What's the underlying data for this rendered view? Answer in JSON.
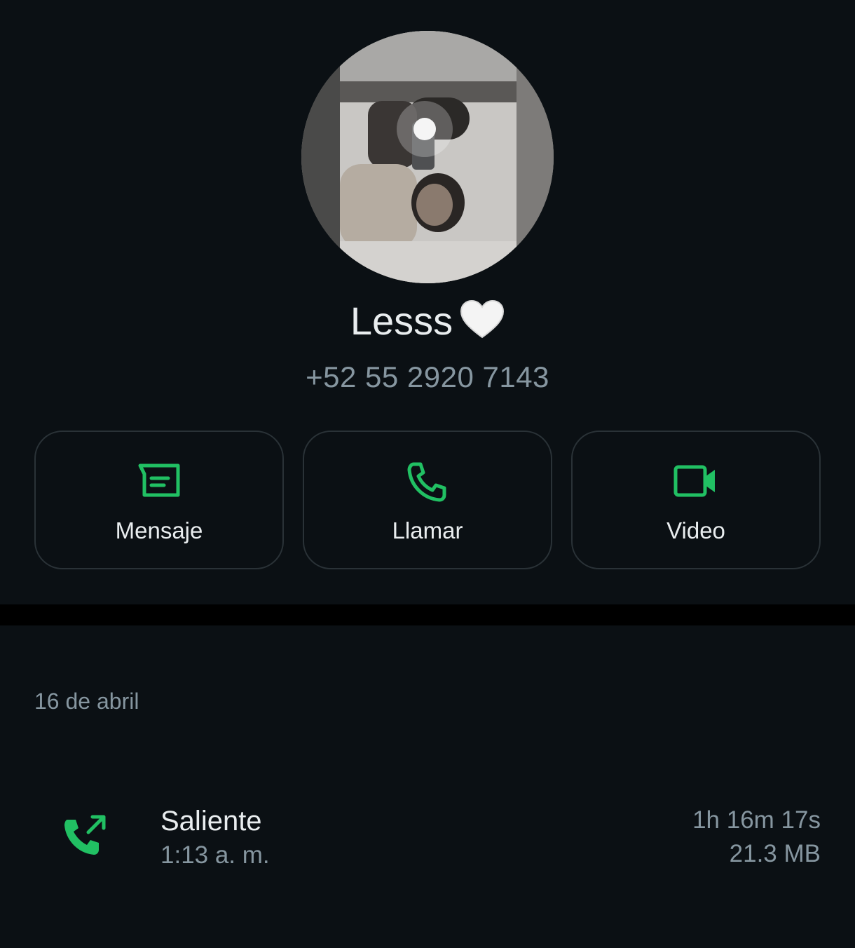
{
  "contact": {
    "name": "Lesss",
    "emoji_icon": "white-heart-icon",
    "phone": "+52 55 2920 7143"
  },
  "actions": [
    {
      "label": "Mensaje",
      "icon": "message-icon"
    },
    {
      "label": "Llamar",
      "icon": "phone-icon"
    },
    {
      "label": "Video",
      "icon": "video-icon"
    }
  ],
  "calls": {
    "date": "16 de abril",
    "entries": [
      {
        "type": "Saliente",
        "time": "1:13 a. m.",
        "duration": "1h 16m 17s",
        "size": "21.3 MB",
        "icon": "outgoing-call-icon"
      }
    ]
  },
  "colors": {
    "background": "#0b1014",
    "accent": "#21c063",
    "primary_text": "#e9edef",
    "secondary_text": "#8696a0"
  }
}
